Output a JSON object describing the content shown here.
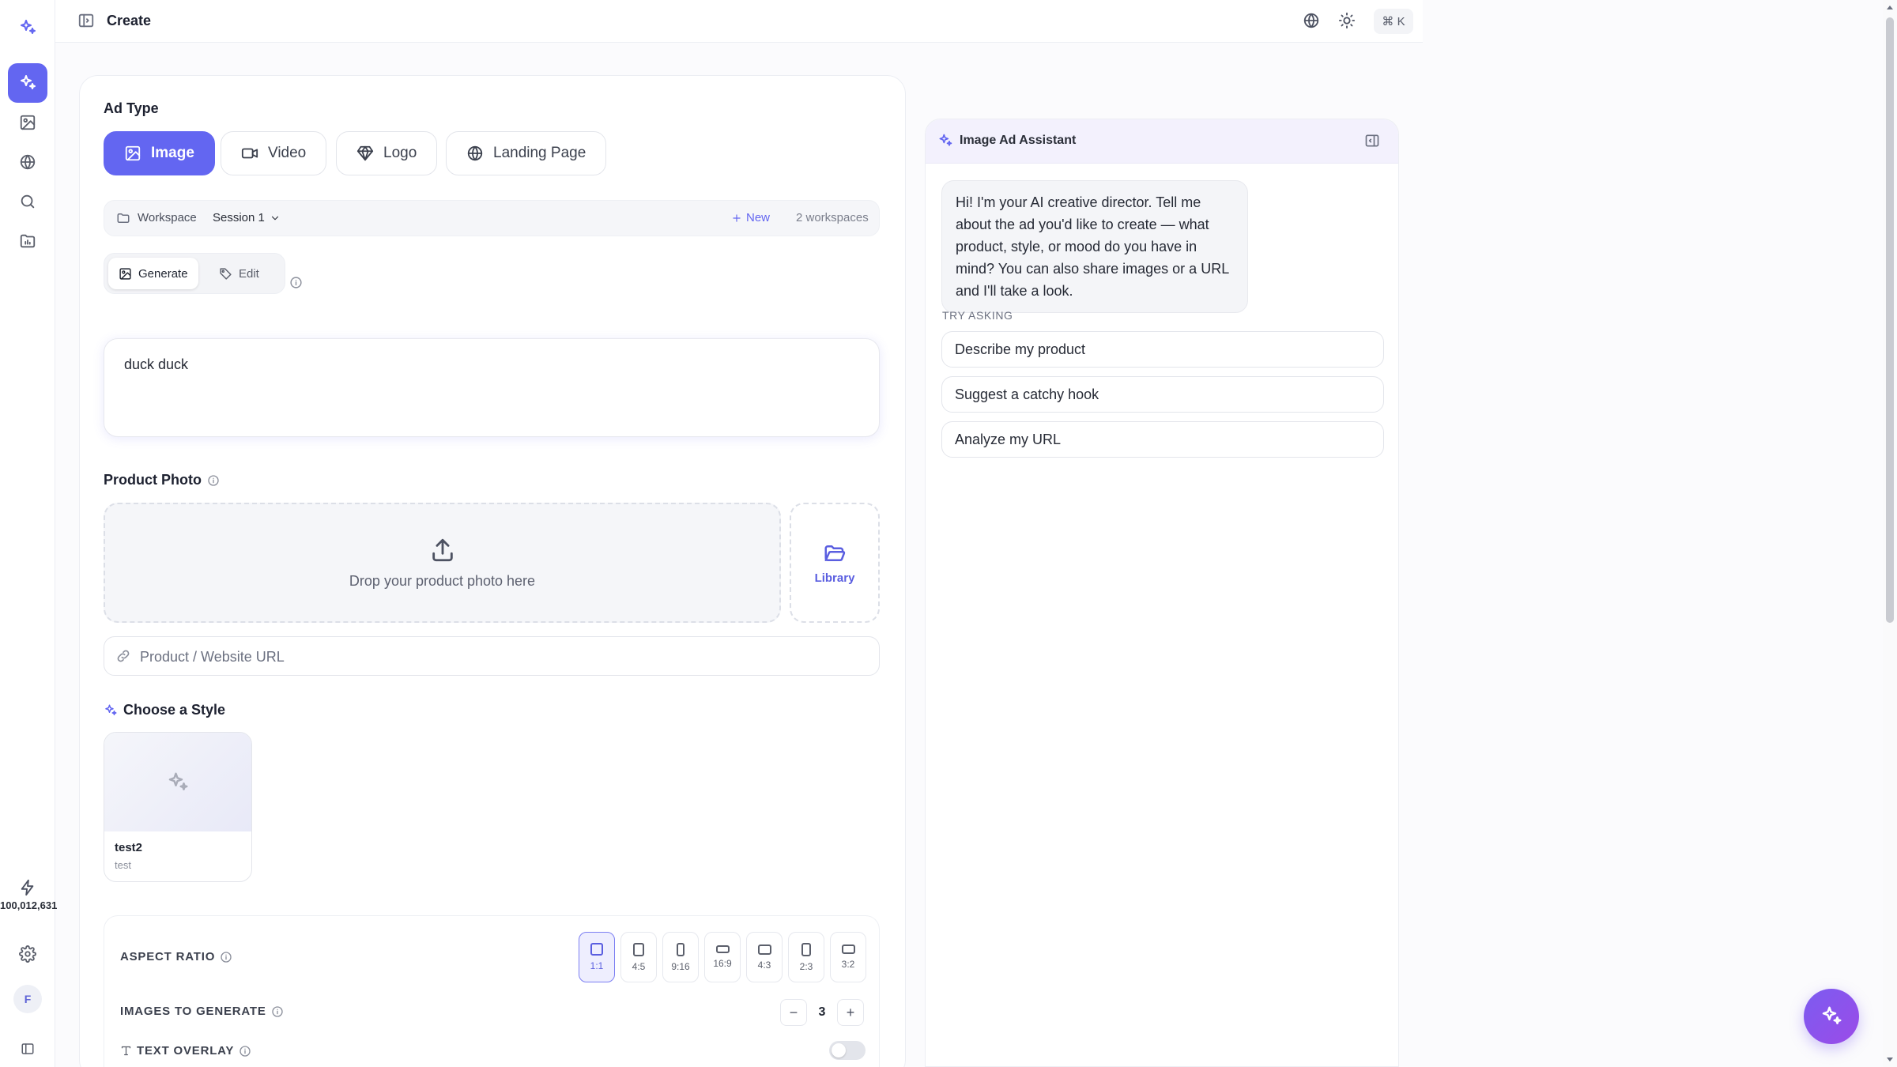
{
  "topbar": {
    "title": "Create",
    "shortcut": "⌘ K"
  },
  "rail": {
    "credits": "100,012,631",
    "avatar_initial": "F"
  },
  "ad_type": {
    "section_title": "Ad Type",
    "options": [
      "Image",
      "Video",
      "Logo",
      "Landing Page"
    ],
    "selected": "Image"
  },
  "workspace": {
    "label": "Workspace",
    "session": "Session 1",
    "new_label": "New",
    "count": "2 workspaces"
  },
  "mode": {
    "generate": "Generate",
    "edit": "Edit",
    "selected": "Generate"
  },
  "prompt": {
    "value": "duck duck"
  },
  "product_photo": {
    "section_title": "Product Photo",
    "drop_text": "Drop your product photo here",
    "library_label": "Library",
    "url_placeholder": "Product / Website URL"
  },
  "style": {
    "section_title": "Choose a Style",
    "cards": [
      {
        "name": "test2",
        "subtitle": "test"
      }
    ]
  },
  "settings": {
    "aspect_ratio_label": "ASPECT RATIO",
    "ratios": [
      "1:1",
      "4:5",
      "9:16",
      "16:9",
      "4:3",
      "2:3",
      "3:2"
    ],
    "selected_ratio": "1:1",
    "images_label": "IMAGES TO GENERATE",
    "images_count": "3",
    "text_overlay_label": "TEXT OVERLAY",
    "text_overlay_on": false
  },
  "assistant": {
    "title": "Image Ad Assistant",
    "greeting": "Hi! I'm your AI creative director. Tell me about the ad you'd like to create — what product, style, or mood do you have in mind? You can also share images or a URL and I'll take a look.",
    "try_label": "TRY ASKING",
    "suggestions": [
      "Describe my product",
      "Suggest a catchy hook",
      "Analyze my URL"
    ]
  },
  "colors": {
    "accent": "#6366f1",
    "fab_gradient_start": "#7c5cf0",
    "fab_gradient_end": "#9b4be8"
  }
}
